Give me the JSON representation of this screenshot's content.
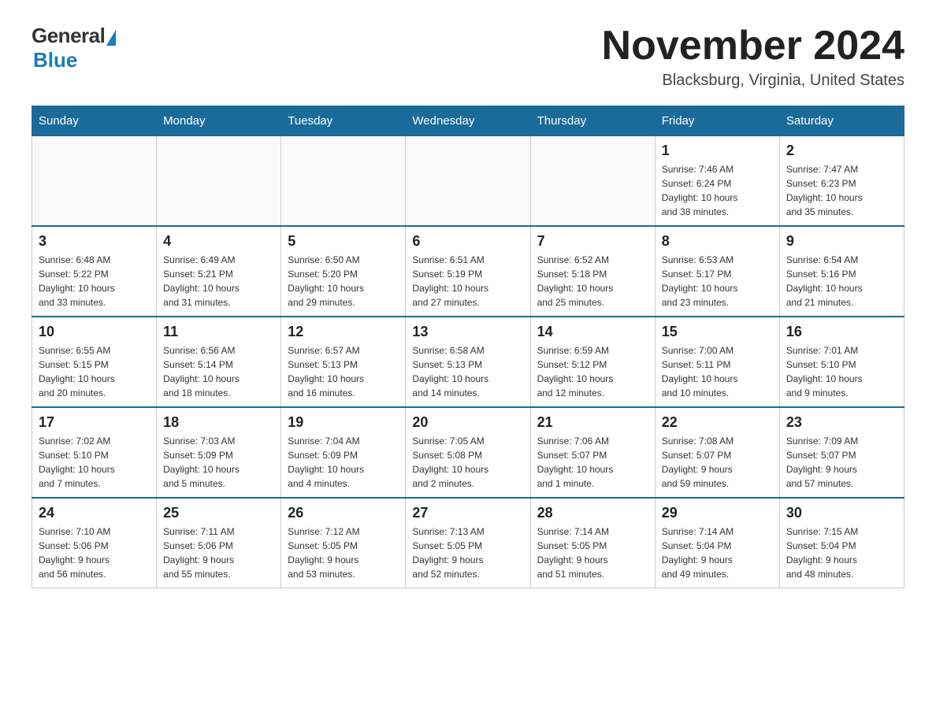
{
  "logo": {
    "general": "General",
    "blue": "Blue"
  },
  "title": "November 2024",
  "location": "Blacksburg, Virginia, United States",
  "days_of_week": [
    "Sunday",
    "Monday",
    "Tuesday",
    "Wednesday",
    "Thursday",
    "Friday",
    "Saturday"
  ],
  "weeks": [
    [
      {
        "day": "",
        "info": ""
      },
      {
        "day": "",
        "info": ""
      },
      {
        "day": "",
        "info": ""
      },
      {
        "day": "",
        "info": ""
      },
      {
        "day": "",
        "info": ""
      },
      {
        "day": "1",
        "info": "Sunrise: 7:46 AM\nSunset: 6:24 PM\nDaylight: 10 hours\nand 38 minutes."
      },
      {
        "day": "2",
        "info": "Sunrise: 7:47 AM\nSunset: 6:23 PM\nDaylight: 10 hours\nand 35 minutes."
      }
    ],
    [
      {
        "day": "3",
        "info": "Sunrise: 6:48 AM\nSunset: 5:22 PM\nDaylight: 10 hours\nand 33 minutes."
      },
      {
        "day": "4",
        "info": "Sunrise: 6:49 AM\nSunset: 5:21 PM\nDaylight: 10 hours\nand 31 minutes."
      },
      {
        "day": "5",
        "info": "Sunrise: 6:50 AM\nSunset: 5:20 PM\nDaylight: 10 hours\nand 29 minutes."
      },
      {
        "day": "6",
        "info": "Sunrise: 6:51 AM\nSunset: 5:19 PM\nDaylight: 10 hours\nand 27 minutes."
      },
      {
        "day": "7",
        "info": "Sunrise: 6:52 AM\nSunset: 5:18 PM\nDaylight: 10 hours\nand 25 minutes."
      },
      {
        "day": "8",
        "info": "Sunrise: 6:53 AM\nSunset: 5:17 PM\nDaylight: 10 hours\nand 23 minutes."
      },
      {
        "day": "9",
        "info": "Sunrise: 6:54 AM\nSunset: 5:16 PM\nDaylight: 10 hours\nand 21 minutes."
      }
    ],
    [
      {
        "day": "10",
        "info": "Sunrise: 6:55 AM\nSunset: 5:15 PM\nDaylight: 10 hours\nand 20 minutes."
      },
      {
        "day": "11",
        "info": "Sunrise: 6:56 AM\nSunset: 5:14 PM\nDaylight: 10 hours\nand 18 minutes."
      },
      {
        "day": "12",
        "info": "Sunrise: 6:57 AM\nSunset: 5:13 PM\nDaylight: 10 hours\nand 16 minutes."
      },
      {
        "day": "13",
        "info": "Sunrise: 6:58 AM\nSunset: 5:13 PM\nDaylight: 10 hours\nand 14 minutes."
      },
      {
        "day": "14",
        "info": "Sunrise: 6:59 AM\nSunset: 5:12 PM\nDaylight: 10 hours\nand 12 minutes."
      },
      {
        "day": "15",
        "info": "Sunrise: 7:00 AM\nSunset: 5:11 PM\nDaylight: 10 hours\nand 10 minutes."
      },
      {
        "day": "16",
        "info": "Sunrise: 7:01 AM\nSunset: 5:10 PM\nDaylight: 10 hours\nand 9 minutes."
      }
    ],
    [
      {
        "day": "17",
        "info": "Sunrise: 7:02 AM\nSunset: 5:10 PM\nDaylight: 10 hours\nand 7 minutes."
      },
      {
        "day": "18",
        "info": "Sunrise: 7:03 AM\nSunset: 5:09 PM\nDaylight: 10 hours\nand 5 minutes."
      },
      {
        "day": "19",
        "info": "Sunrise: 7:04 AM\nSunset: 5:09 PM\nDaylight: 10 hours\nand 4 minutes."
      },
      {
        "day": "20",
        "info": "Sunrise: 7:05 AM\nSunset: 5:08 PM\nDaylight: 10 hours\nand 2 minutes."
      },
      {
        "day": "21",
        "info": "Sunrise: 7:06 AM\nSunset: 5:07 PM\nDaylight: 10 hours\nand 1 minute."
      },
      {
        "day": "22",
        "info": "Sunrise: 7:08 AM\nSunset: 5:07 PM\nDaylight: 9 hours\nand 59 minutes."
      },
      {
        "day": "23",
        "info": "Sunrise: 7:09 AM\nSunset: 5:07 PM\nDaylight: 9 hours\nand 57 minutes."
      }
    ],
    [
      {
        "day": "24",
        "info": "Sunrise: 7:10 AM\nSunset: 5:06 PM\nDaylight: 9 hours\nand 56 minutes."
      },
      {
        "day": "25",
        "info": "Sunrise: 7:11 AM\nSunset: 5:06 PM\nDaylight: 9 hours\nand 55 minutes."
      },
      {
        "day": "26",
        "info": "Sunrise: 7:12 AM\nSunset: 5:05 PM\nDaylight: 9 hours\nand 53 minutes."
      },
      {
        "day": "27",
        "info": "Sunrise: 7:13 AM\nSunset: 5:05 PM\nDaylight: 9 hours\nand 52 minutes."
      },
      {
        "day": "28",
        "info": "Sunrise: 7:14 AM\nSunset: 5:05 PM\nDaylight: 9 hours\nand 51 minutes."
      },
      {
        "day": "29",
        "info": "Sunrise: 7:14 AM\nSunset: 5:04 PM\nDaylight: 9 hours\nand 49 minutes."
      },
      {
        "day": "30",
        "info": "Sunrise: 7:15 AM\nSunset: 5:04 PM\nDaylight: 9 hours\nand 48 minutes."
      }
    ]
  ]
}
